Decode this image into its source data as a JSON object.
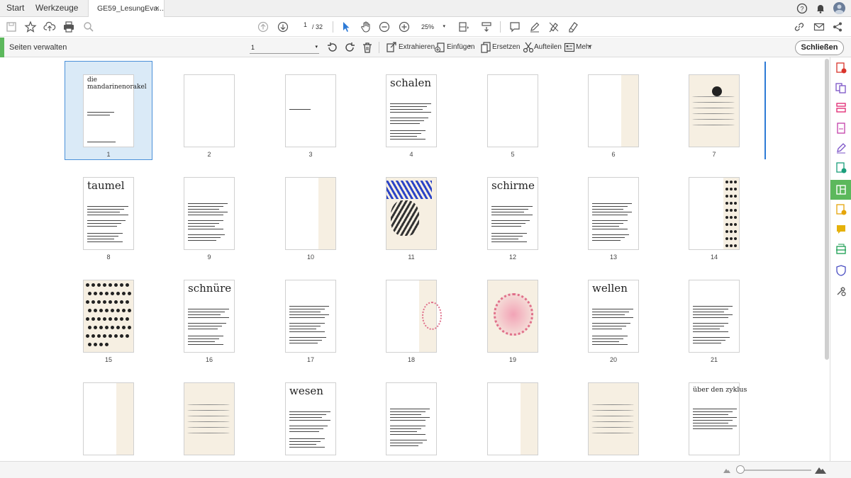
{
  "tabbar": {
    "home_label": "Start",
    "tools_label": "Werkzeuge",
    "doc_tab_label": "GE59_LesungEva...",
    "close_glyph": "×"
  },
  "toolbar": {
    "page_current": "1",
    "page_total": "/ 32",
    "zoom": "25%",
    "icons": [
      "save-icon",
      "star-icon",
      "upload-cloud-icon",
      "print-icon",
      "search-icon",
      "arrow-up-icon",
      "arrow-down-icon",
      "pointer-icon",
      "hand-icon",
      "zoom-out-icon",
      "zoom-in-icon",
      "fit-icon",
      "scroll-icon",
      "comment-icon",
      "pen-icon",
      "highlight-icon",
      "sign-icon",
      "link-icon",
      "mail-icon",
      "share-icon",
      "help-icon",
      "bell-icon",
      "avatar"
    ]
  },
  "managebar": {
    "title": "Seiten verwalten",
    "page_select": "1",
    "extract_label": "Extrahieren",
    "insert_label": "Einfügen",
    "replace_label": "Ersetzen",
    "split_label": "Aufteilen",
    "more_label": "Mehr",
    "close_label": "Schließen"
  },
  "pages": [
    {
      "num": "1",
      "title": "die\nmandarinenorakel"
    },
    {
      "num": "2",
      "title": ""
    },
    {
      "num": "3",
      "title": ""
    },
    {
      "num": "4",
      "title": "schalen"
    },
    {
      "num": "5",
      "title": ""
    },
    {
      "num": "6",
      "title": ""
    },
    {
      "num": "7",
      "title": ""
    },
    {
      "num": "8",
      "title": "taumel"
    },
    {
      "num": "9",
      "title": ""
    },
    {
      "num": "10",
      "title": ""
    },
    {
      "num": "11",
      "title": ""
    },
    {
      "num": "12",
      "title": "schirme"
    },
    {
      "num": "13",
      "title": ""
    },
    {
      "num": "14",
      "title": ""
    },
    {
      "num": "15",
      "title": ""
    },
    {
      "num": "16",
      "title": "schnüre"
    },
    {
      "num": "17",
      "title": ""
    },
    {
      "num": "18",
      "title": ""
    },
    {
      "num": "19",
      "title": ""
    },
    {
      "num": "20",
      "title": "wellen"
    },
    {
      "num": "21",
      "title": ""
    },
    {
      "num": "",
      "title": ""
    },
    {
      "num": "",
      "title": ""
    },
    {
      "num": "",
      "title": "wesen"
    },
    {
      "num": "",
      "title": ""
    },
    {
      "num": "",
      "title": ""
    },
    {
      "num": "",
      "title": ""
    },
    {
      "num": "",
      "title": "über den zyklus"
    }
  ],
  "colors": {
    "accent_green": "#5cb85c",
    "selection_blue": "#4a90d9",
    "scroll_marker": "#2d7ad6"
  }
}
